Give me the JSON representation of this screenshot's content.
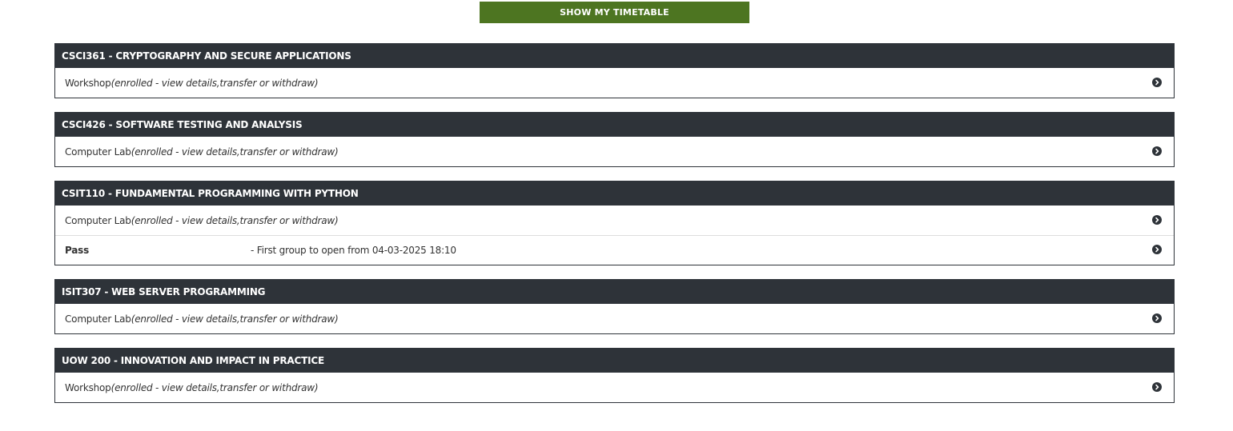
{
  "timetable_button": {
    "label": "SHOW MY TIMETABLE"
  },
  "courses": [
    {
      "title": "CSCI361 - CRYPTOGRAPHY AND SECURE APPLICATIONS",
      "rows": [
        {
          "type": "Workshop",
          "status": "(enrolled - view details,transfer or withdraw)"
        }
      ]
    },
    {
      "title": "CSCI426 - SOFTWARE TESTING AND ANALYSIS",
      "rows": [
        {
          "type": "Computer Lab",
          "status": "(enrolled - view details,transfer or withdraw)"
        }
      ]
    },
    {
      "title": "CSIT110 - FUNDAMENTAL PROGRAMMING WITH PYTHON",
      "rows": [
        {
          "type": "Computer Lab",
          "status": "(enrolled - view details,transfer or withdraw)"
        }
      ],
      "pass": {
        "label": "Pass",
        "note": "- First group to open from 04-03-2025 18:10"
      }
    },
    {
      "title": "ISIT307 - WEB SERVER PROGRAMMING",
      "rows": [
        {
          "type": "Computer Lab",
          "status": "(enrolled - view details,transfer or withdraw)"
        }
      ]
    },
    {
      "title": "UOW 200 - INNOVATION AND IMPACT IN PRACTICE",
      "rows": [
        {
          "type": "Workshop",
          "status": "(enrolled - view details,transfer or withdraw)"
        }
      ]
    }
  ],
  "icons": {
    "row_arrow": "chevron-right-circle-icon"
  },
  "colors": {
    "button_green": "#4d7521",
    "header_dark": "#2e3339"
  }
}
